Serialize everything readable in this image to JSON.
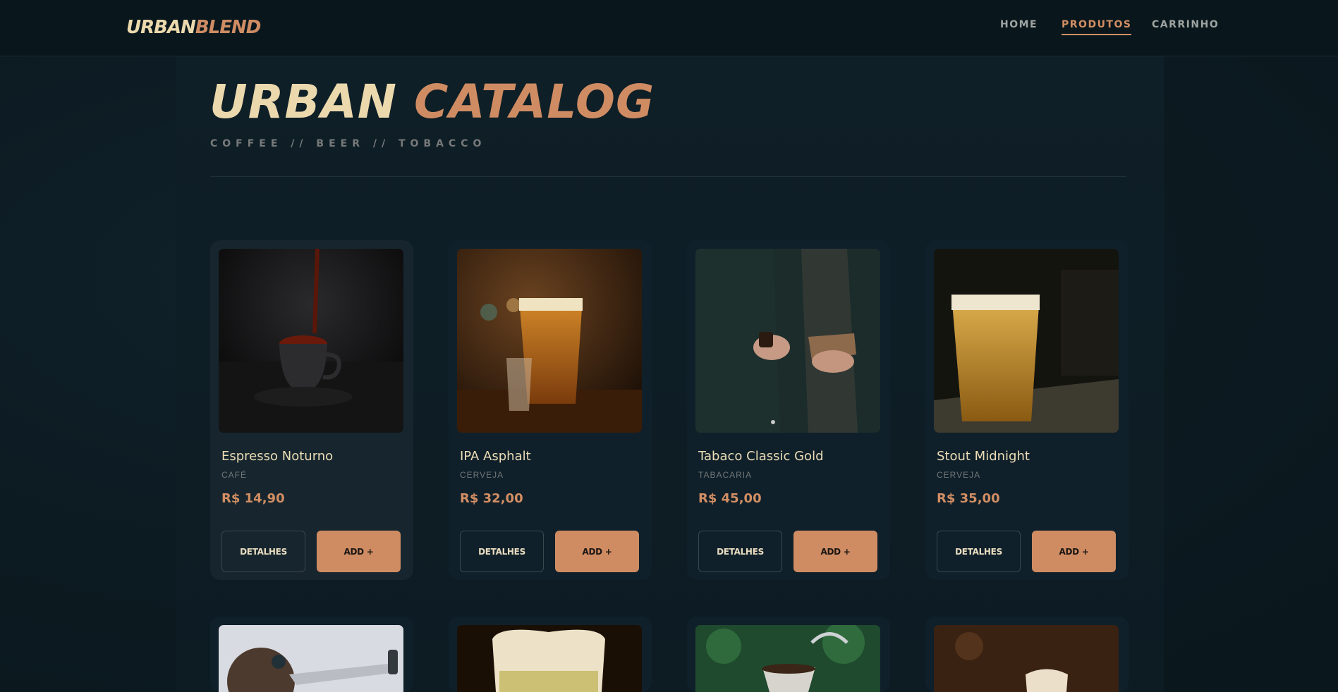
{
  "brand": {
    "part1": "URBAN",
    "part2": "BLEND"
  },
  "nav": [
    {
      "label": "HOME"
    },
    {
      "label": "PRODUTOS"
    },
    {
      "label": "CARRINHO"
    }
  ],
  "hero": {
    "title_part1": "URBAN",
    "title_part2": "CATALOG",
    "subtitle": "COFFEE // BEER // TOBACCO"
  },
  "buttons": {
    "details": "DETALHES",
    "add": "ADD +"
  },
  "products": [
    {
      "name": "Espresso Noturno",
      "category": "CAFÉ",
      "price": "R$ 14,90",
      "image": "espresso-cup-image"
    },
    {
      "name": "IPA Asphalt",
      "category": "CERVEJA",
      "price": "R$ 32,00",
      "image": "ipa-beer-image"
    },
    {
      "name": "Tabaco Classic Gold",
      "category": "TABACARIA",
      "price": "R$ 45,00",
      "image": "pipe-tobacco-image"
    },
    {
      "name": "Stout Midnight",
      "category": "CERVEJA",
      "price": "R$ 35,00",
      "image": "pint-beer-image"
    }
  ],
  "more_products_images": [
    "coffee-grinder-image",
    "foamy-beer-image",
    "pour-over-coffee-image",
    "cappuccino-image"
  ],
  "colors": {
    "accent": "#cf8c63",
    "cream": "#ebd9ad",
    "background": "#0c1a21"
  }
}
